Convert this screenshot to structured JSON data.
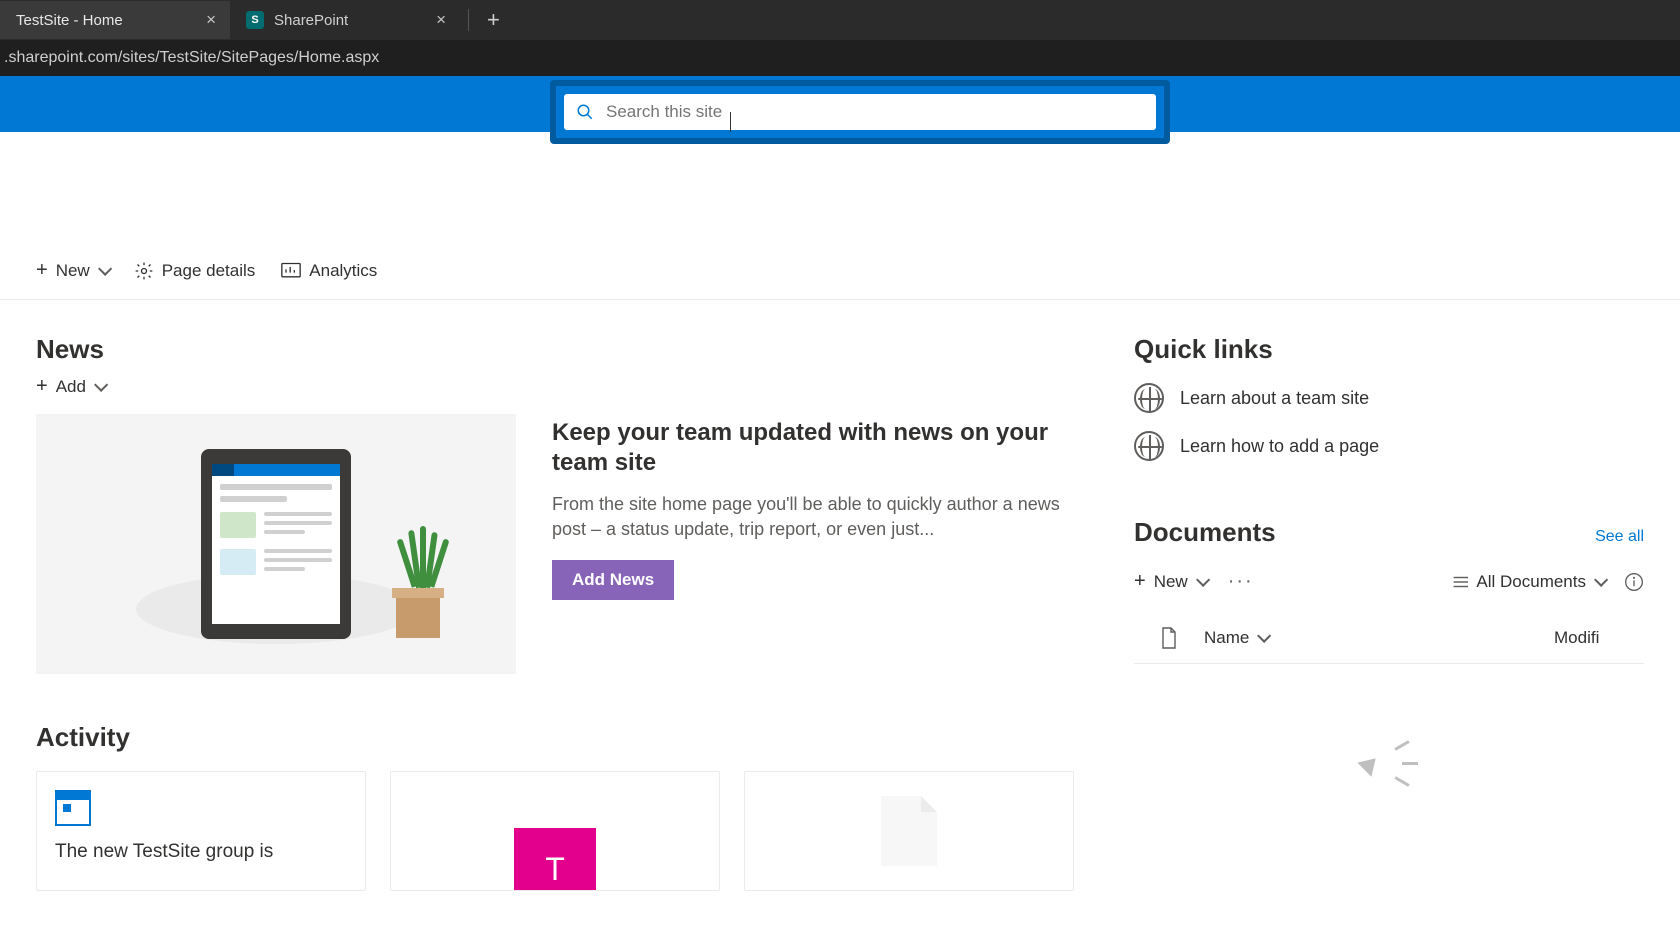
{
  "browser": {
    "tabs": [
      {
        "title": "TestSite - Home",
        "active": true
      },
      {
        "title": "SharePoint",
        "active": false,
        "favicon_letter": "S",
        "favicon_bg": "#036c70",
        "favicon_fg": "#fff"
      }
    ],
    "url": ".sharepoint.com/sites/TestSite/SitePages/Home.aspx"
  },
  "search": {
    "placeholder": "Search this site"
  },
  "commandBar": {
    "new": "New",
    "pageDetails": "Page details",
    "analytics": "Analytics"
  },
  "news": {
    "heading": "News",
    "add": "Add",
    "promoTitle": "Keep your team updated with news on your team site",
    "promoDesc": "From the site home page you'll be able to quickly author a news post – a status update, trip report, or even just...",
    "addNews": "Add News"
  },
  "activity": {
    "heading": "Activity",
    "card1": "The new TestSite group is",
    "card2_letter": "T"
  },
  "quickLinks": {
    "heading": "Quick links",
    "items": [
      "Learn about a team site",
      "Learn how to add a page"
    ]
  },
  "documents": {
    "heading": "Documents",
    "seeAll": "See all",
    "new": "New",
    "view": "All Documents",
    "col_name": "Name",
    "col_modified": "Modifi"
  }
}
